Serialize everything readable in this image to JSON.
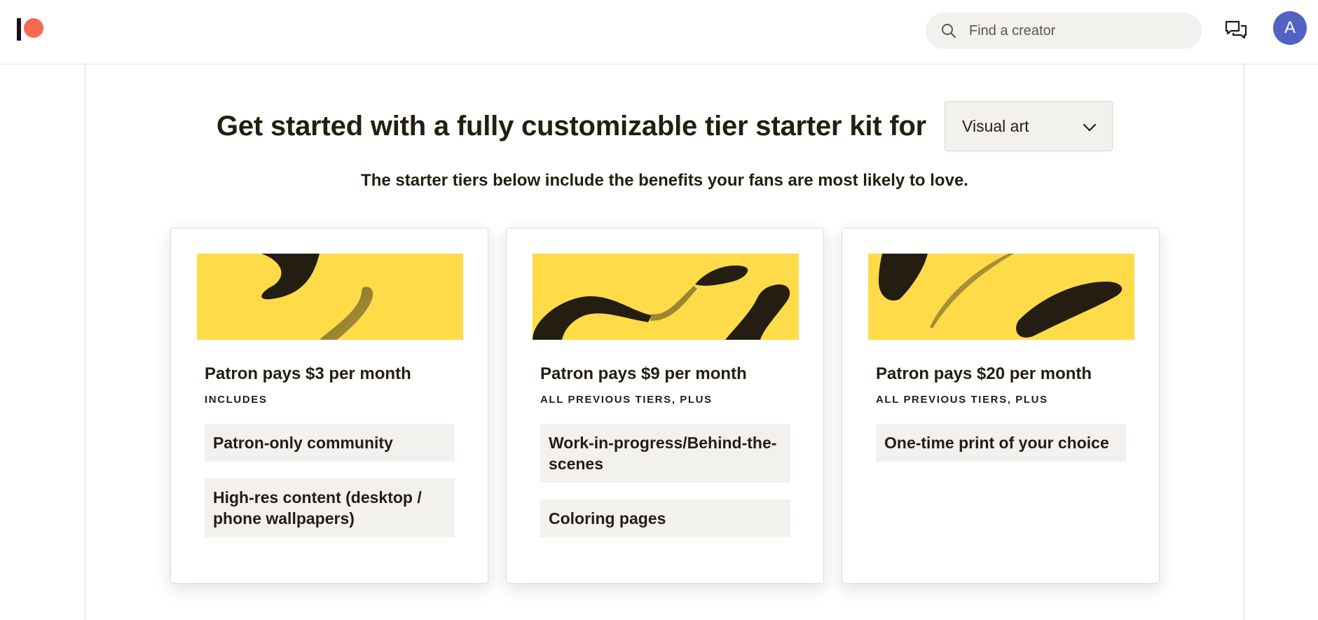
{
  "header": {
    "logo_icon": "patreon-logo-icon",
    "search": {
      "icon": "search-icon",
      "placeholder": "Find a creator"
    },
    "messages_icon": "messages-icon",
    "avatar_initial": "A",
    "avatar_color": "#5162c4"
  },
  "main": {
    "heading": "Get started with a fully customizable tier starter kit for",
    "category_select": {
      "selected": "Visual art",
      "icon": "chevron-down-icon"
    },
    "subheading": "The starter tiers below include the benefits your fans are most likely to love.",
    "tiers": [
      {
        "title": "Patron pays $3 per month",
        "includes_label": "INCLUDES",
        "benefits": [
          "Patron-only community",
          "High-res content (desktop / phone wallpapers)"
        ]
      },
      {
        "title": "Patron pays $9 per month",
        "includes_label": "ALL PREVIOUS TIERS, PLUS",
        "benefits": [
          "Work-in-progress/Behind-the-scenes",
          "Coloring pages"
        ]
      },
      {
        "title": "Patron pays $20 per month",
        "includes_label": "ALL PREVIOUS TIERS, PLUS",
        "benefits": [
          "One-time print of your choice"
        ]
      }
    ]
  },
  "colors": {
    "brand_accent": "#f96854",
    "banner_yellow": "#ffdb4a",
    "brush_dark": "#241e12",
    "text": "#241e12",
    "benefit_bg": "#f2f1ee"
  }
}
